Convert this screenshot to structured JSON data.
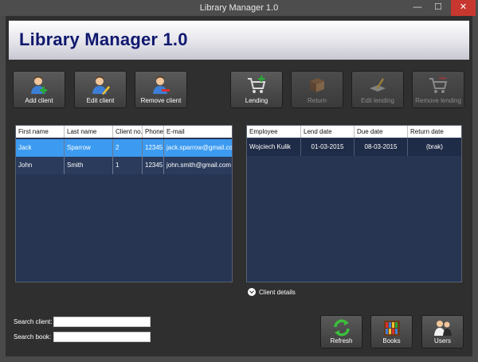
{
  "window": {
    "title": "Library Manager 1.0",
    "min": "—",
    "max": "☐",
    "close": "✕"
  },
  "header": {
    "title": "Library Manager 1.0"
  },
  "toolbar": [
    {
      "label": "Add client",
      "icon": "add-client-icon",
      "enabled": true
    },
    {
      "label": "Edit client",
      "icon": "edit-client-icon",
      "enabled": true
    },
    {
      "label": "Remove client",
      "icon": "remove-client-icon",
      "enabled": true
    },
    {
      "label": "Lending",
      "icon": "lending-cart-icon",
      "enabled": true
    },
    {
      "label": "Return",
      "icon": "return-book-icon",
      "enabled": false
    },
    {
      "label": "Edit lending",
      "icon": "edit-lending-icon",
      "enabled": false
    },
    {
      "label": "Remove lending",
      "icon": "remove-lending-icon",
      "enabled": false
    }
  ],
  "clients": {
    "columns": [
      "First name",
      "Last name",
      "Client no.",
      "Phone",
      "E-mail"
    ],
    "rows": [
      [
        "Jack",
        "Sparrow",
        "2",
        "12345",
        "jack.sparrow@gmail.com"
      ],
      [
        "John",
        "Smith",
        "1",
        "12345",
        "john.smith@gmail.com"
      ]
    ],
    "selected_index": 0
  },
  "lendings": {
    "columns": [
      "Employee",
      "Lend date",
      "Due date",
      "Return date"
    ],
    "rows": [
      [
        "Wojciech Kulik",
        "01-03-2015",
        "08-03-2015",
        "(brak)"
      ]
    ]
  },
  "details": {
    "label": "Client details"
  },
  "search": {
    "client_label": "Search client:",
    "client_value": "",
    "book_label": "Search book:",
    "book_value": ""
  },
  "bottom_buttons": [
    {
      "label": "Refresh",
      "icon": "refresh-icon"
    },
    {
      "label": "Books",
      "icon": "books-icon"
    },
    {
      "label": "Users",
      "icon": "users-icon"
    }
  ],
  "colors": {
    "selected_row": "#3c9bf0",
    "grid_bg": "#273553",
    "header_title": "#10186e",
    "close_button": "#c7372f"
  }
}
